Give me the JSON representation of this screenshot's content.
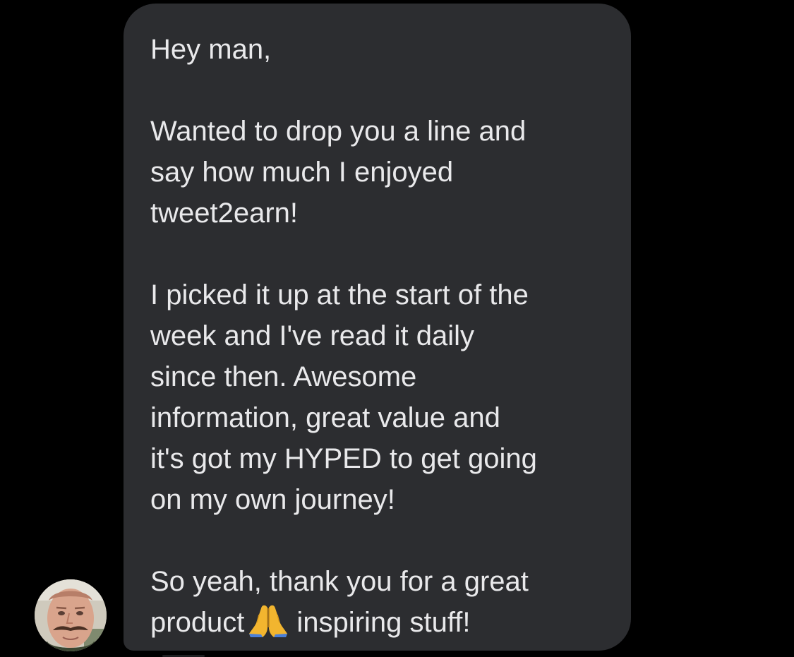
{
  "message": {
    "greeting": "Hey man,",
    "paragraph_2": [
      "Wanted to drop you a line and",
      "say how much I enjoyed",
      "tweet2earn!"
    ],
    "paragraph_3": [
      "I picked it up at the start of the",
      "week and I've read it daily",
      "since then. Awesome",
      "information, great value and",
      "it's got my HYPED to get going",
      "on my own journey!"
    ],
    "paragraph_4_line_1": "So yeah, thank you for a great",
    "paragraph_4_line_2_before": "product",
    "paragraph_4_line_2_after": "inspiring stuff!",
    "emoji": "folded-hands-icon"
  },
  "sender": {
    "avatar_icon": "avatar"
  },
  "colors": {
    "background": "#000000",
    "bubble": "#2c2d30",
    "text": "#e9e9eb",
    "emoji": "#f2b52f"
  }
}
